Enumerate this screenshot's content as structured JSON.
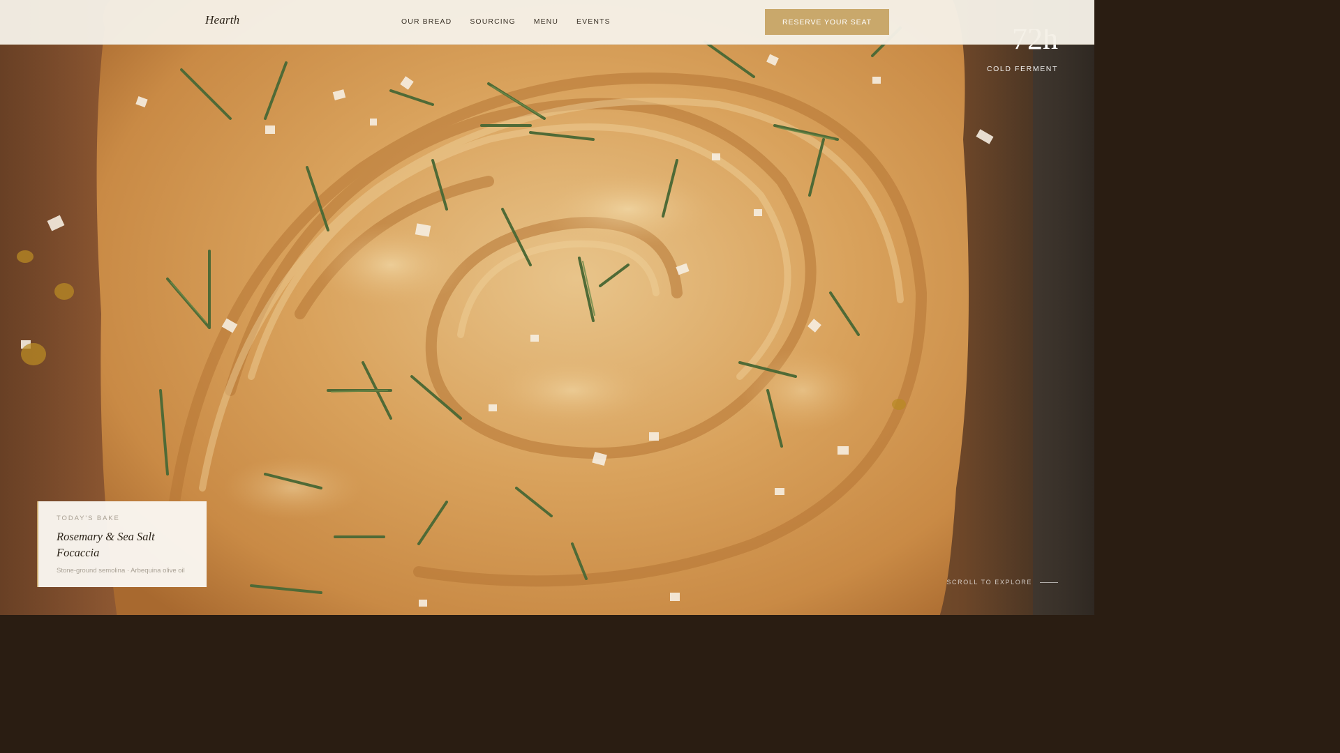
{
  "brand": {
    "name": "Hearth"
  },
  "nav": {
    "items": [
      {
        "label": "OUR BREAD"
      },
      {
        "label": "SOURCING"
      },
      {
        "label": "MENU"
      },
      {
        "label": "EVENTS"
      }
    ],
    "cta_label": "RESERVE YOUR SEAT"
  },
  "hero": {
    "image_icon": "focaccia-photo",
    "stat": {
      "value": "72h",
      "label": "COLD FERMENT"
    },
    "scroll_label": "SCROLL TO EXPLORE"
  },
  "todays_bake": {
    "eyebrow": "TODAY'S BAKE",
    "title": "Rosemary & Sea Salt Focaccia",
    "meta": "Stone-ground semolina · Arbequina olive oil"
  },
  "colors": {
    "accent": "#c9a86b",
    "nav_background": "#f5f0e7",
    "text_dark": "#2c2419"
  }
}
